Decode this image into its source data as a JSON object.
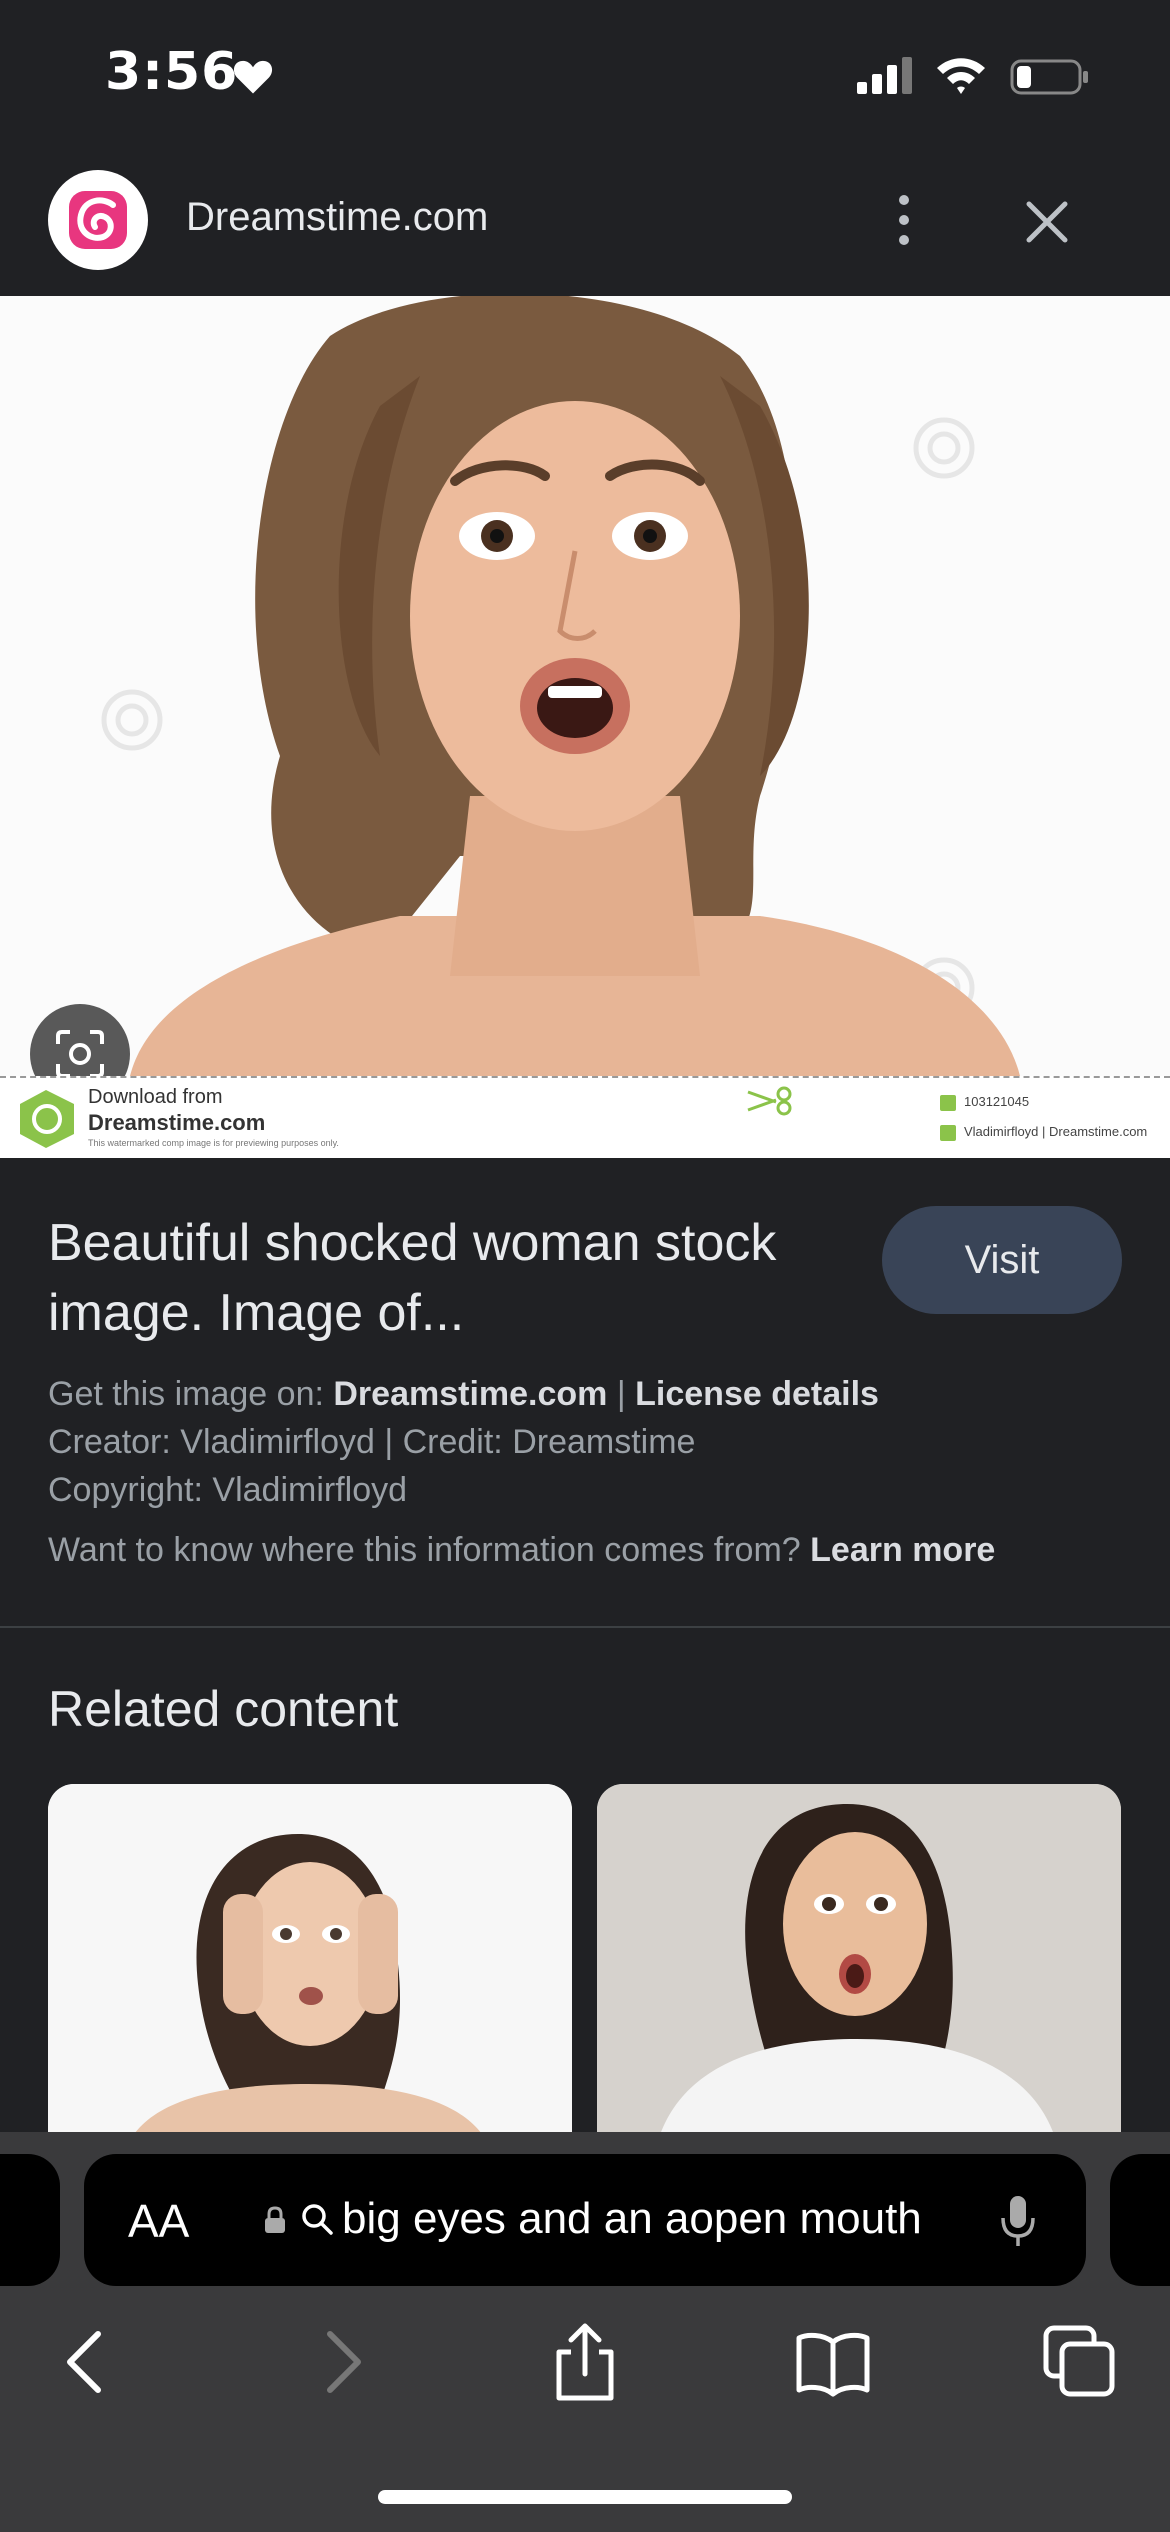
{
  "status_bar": {
    "time": "3:56"
  },
  "header": {
    "site_name": "Dreamstime.com"
  },
  "image": {
    "watermark_download_from": "Download from",
    "watermark_site": "Dreamstime.com",
    "watermark_note": "This watermarked comp image is for previewing purposes only.",
    "image_id": "103121045",
    "image_credit": "Vladimirfloyd | Dreamstime.com"
  },
  "info": {
    "title": "Beautiful shocked woman stock image. Image of...",
    "visit_label": "Visit",
    "get_image_prefix": "Get this image on:",
    "get_image_site": "Dreamstime.com",
    "separator": "|",
    "license_details": "License details",
    "creator_line": "Creator: Vladimirfloyd | Credit: Dreamstime",
    "copyright_line": "Copyright: Vladimirfloyd",
    "info_question": "Want to know where this information comes from?",
    "learn_more": "Learn more"
  },
  "related": {
    "title": "Related content"
  },
  "browser": {
    "text_size_label": "AA",
    "address": "big eyes and an aopen mouth"
  },
  "colors": {
    "background": "#202124",
    "visit_button": "#394457",
    "brand_pink": "#e8367f",
    "brand_green": "#8bc34a"
  }
}
